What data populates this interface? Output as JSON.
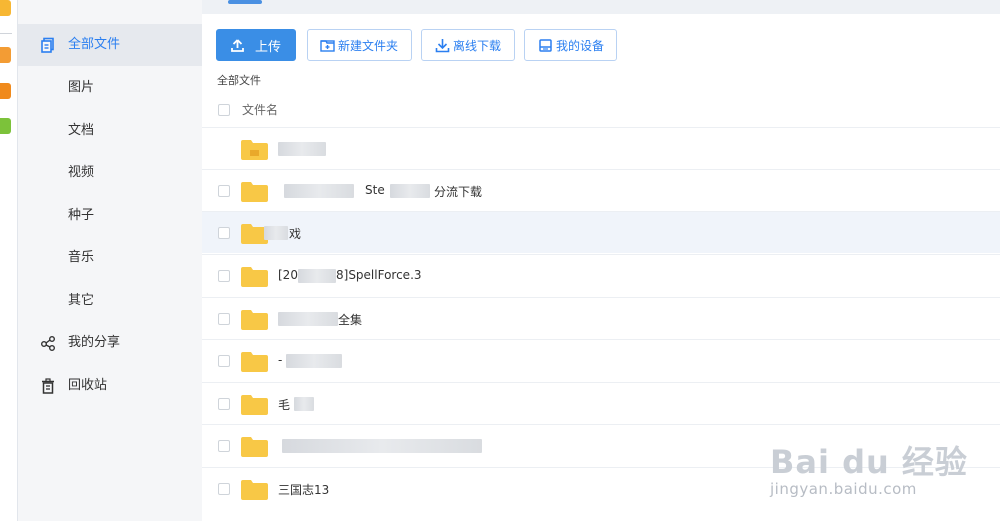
{
  "sidebar": {
    "items": [
      {
        "label": "全部文件",
        "icon": "file-copy-icon"
      },
      {
        "label": "图片"
      },
      {
        "label": "文档"
      },
      {
        "label": "视频"
      },
      {
        "label": "种子"
      },
      {
        "label": "音乐"
      },
      {
        "label": "其它"
      },
      {
        "label": "我的分享",
        "icon": "share-icon"
      },
      {
        "label": "回收站",
        "icon": "trash-icon"
      }
    ]
  },
  "toolbar": {
    "upload_label": "上传",
    "new_folder_label": "新建文件夹",
    "offline_download_label": "离线下载",
    "my_devices_label": "我的设备"
  },
  "breadcrumb": "全部文件",
  "list_header": {
    "name_label": "文件名"
  },
  "files": [
    {
      "name": "",
      "has_checkbox": false
    },
    {
      "name": "Ste",
      "suffix": "分流下载"
    },
    {
      "name": "",
      "suffix": "戏"
    },
    {
      "name": "[20",
      "suffix": "8]SpellForce.3"
    },
    {
      "name": "",
      "suffix": "全集"
    },
    {
      "name": "-",
      "suffix": ""
    },
    {
      "name": "毛",
      "suffix": ""
    },
    {
      "name": "",
      "suffix": ""
    },
    {
      "name": "三国志13",
      "suffix": ""
    }
  ],
  "watermark": {
    "logo": "Bai du 经验",
    "url": "jingyan.baidu.com"
  },
  "colors": {
    "accent": "#3a8ee6",
    "folder": "#f8c846",
    "sidebar_bg": "#f5f6f8"
  }
}
